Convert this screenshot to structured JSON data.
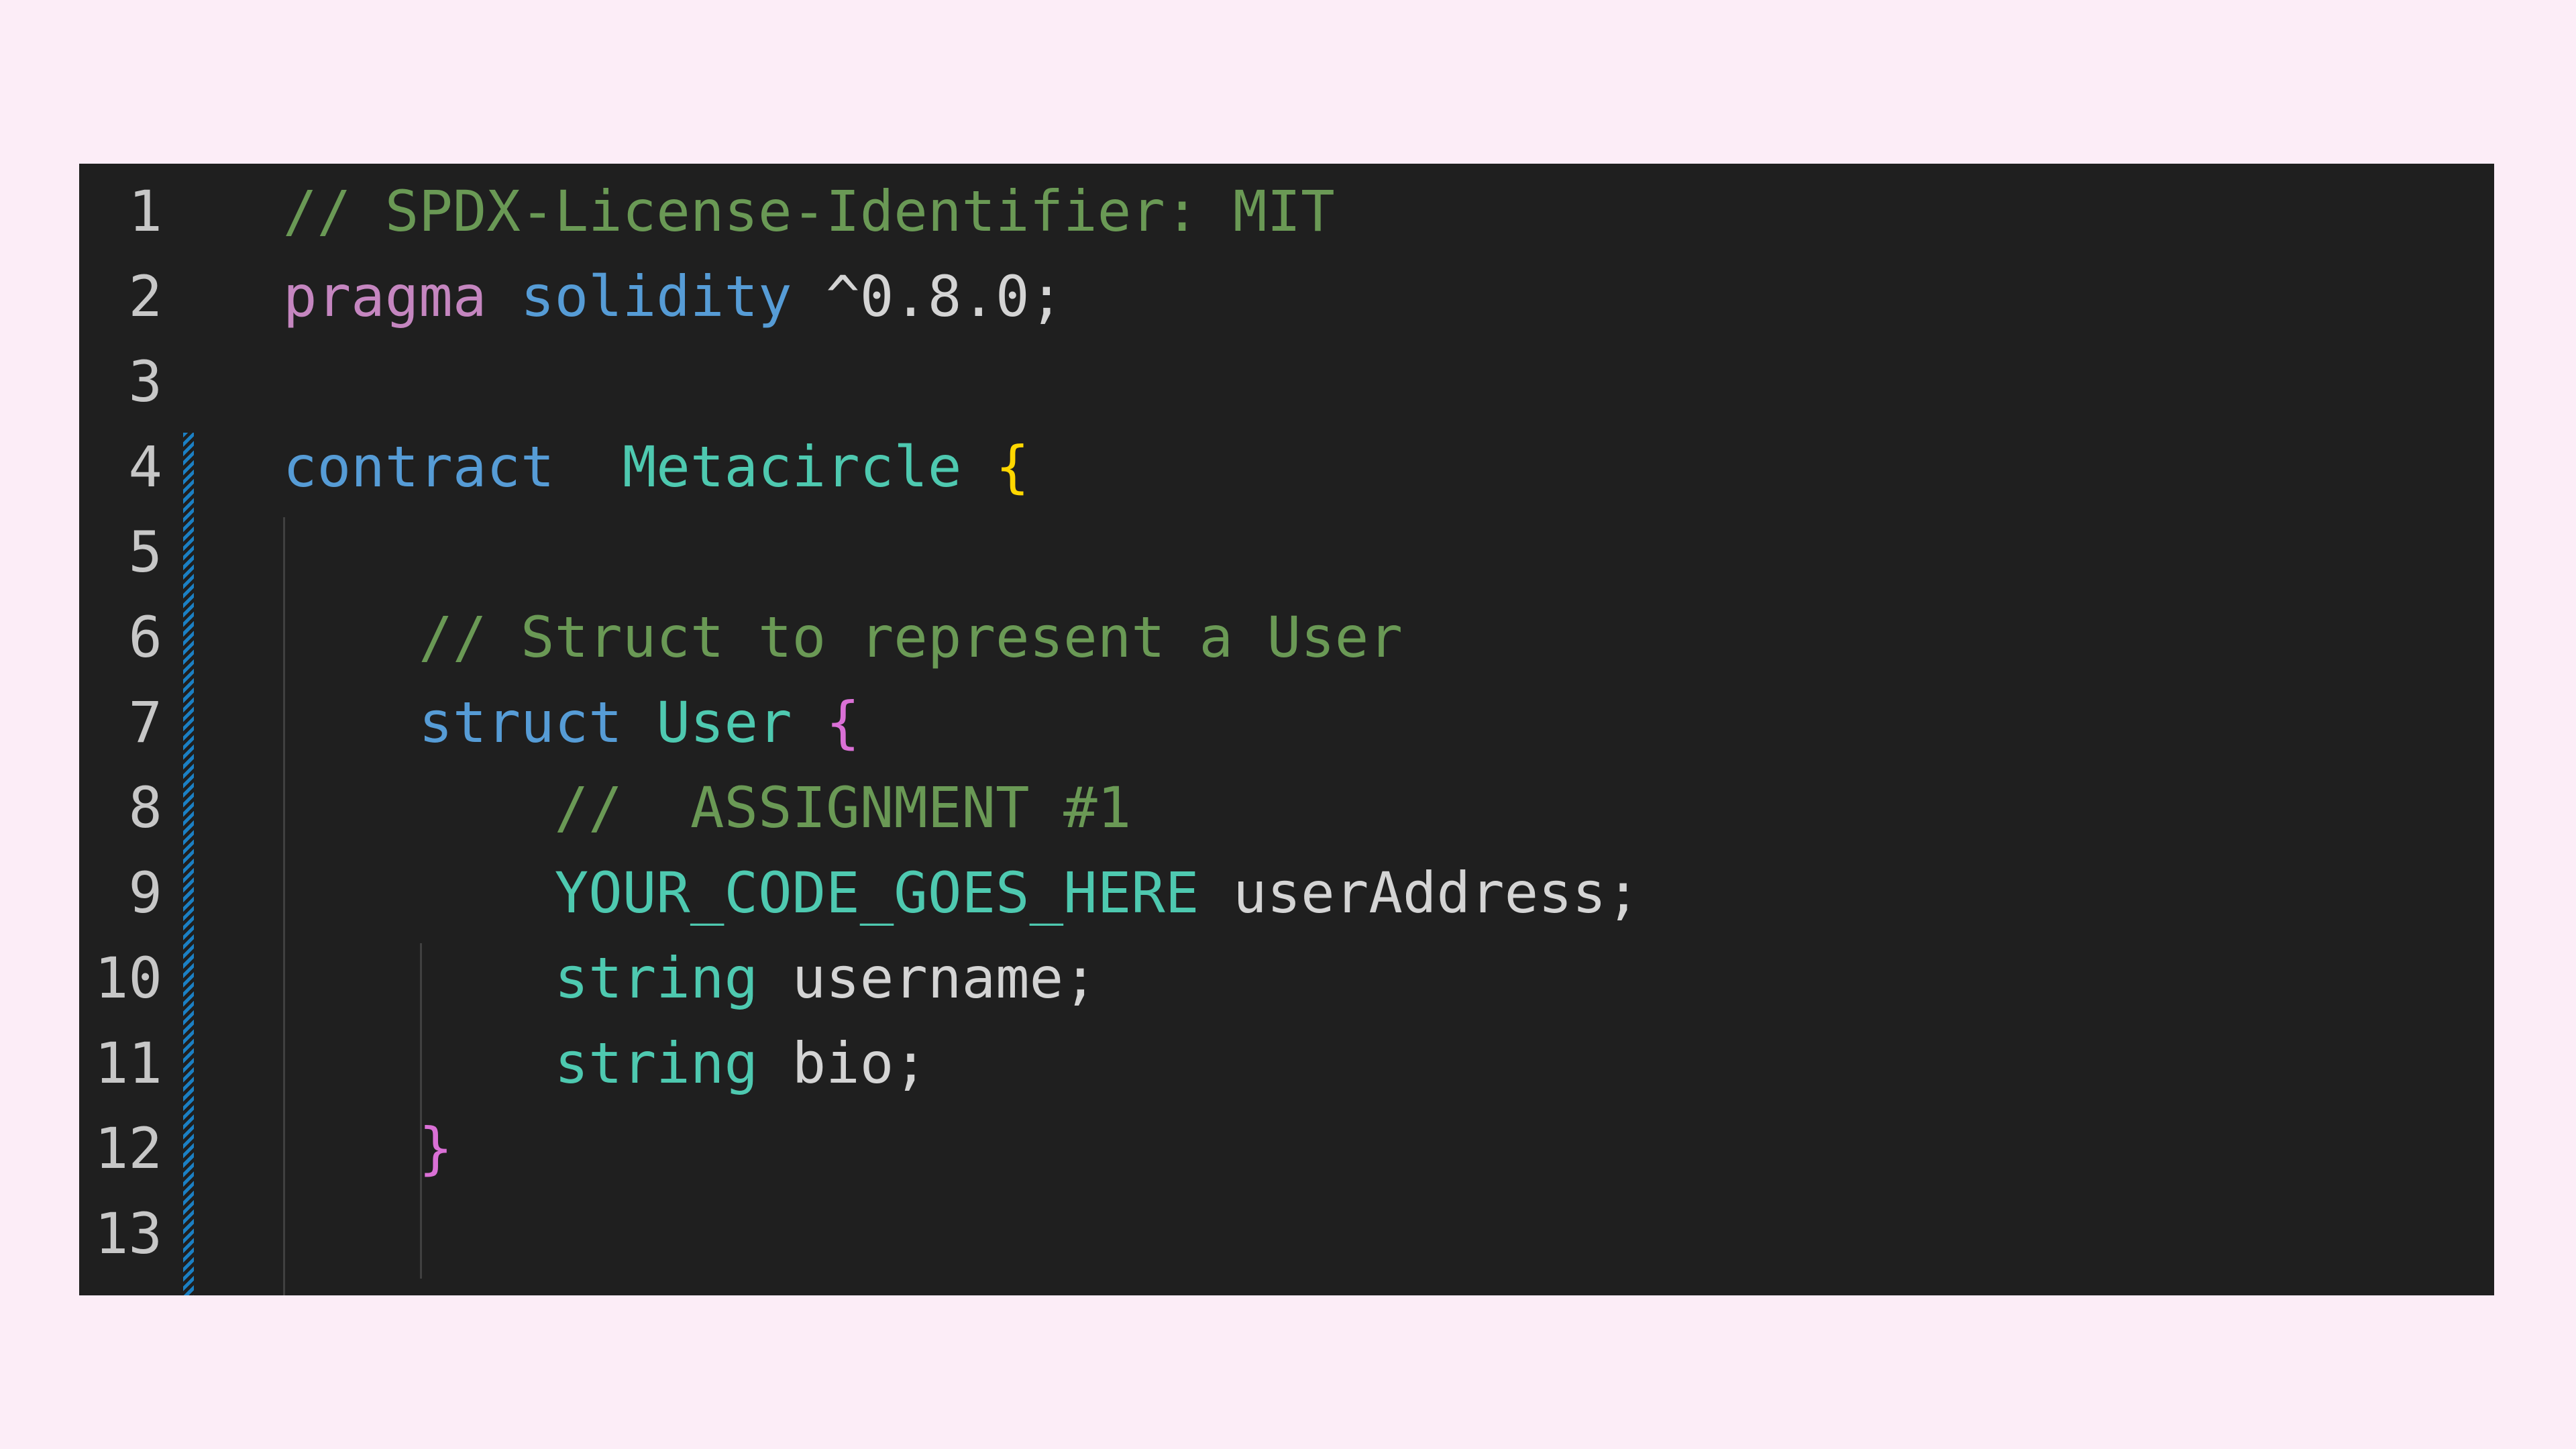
{
  "colors": {
    "page_background": "#fcedf7",
    "editor_background": "#1f1f1f",
    "line_number": "#c7c7c7",
    "comment": "#6a9955",
    "keyword_purple": "#c586c0",
    "keyword_blue": "#569cd6",
    "type_teal": "#4ec9b0",
    "plain": "#d4d4d4",
    "bracket_yellow": "#ffd700",
    "bracket_pink": "#da70d6",
    "modified_gutter": "#1b80c4",
    "indent_guide": "#404040"
  },
  "editor": {
    "lines": [
      {
        "number": "1",
        "tokens": [
          {
            "text": "// SPDX-License-Identifier: MIT",
            "kind": "comment"
          }
        ]
      },
      {
        "number": "2",
        "tokens": [
          {
            "text": "pragma",
            "kind": "keyword_purple"
          },
          {
            "text": " ",
            "kind": "plain"
          },
          {
            "text": "solidity",
            "kind": "keyword_blue"
          },
          {
            "text": " ^0.8.0;",
            "kind": "plain"
          }
        ]
      },
      {
        "number": "3",
        "tokens": []
      },
      {
        "number": "4",
        "tokens": [
          {
            "text": "contract",
            "kind": "keyword_blue"
          },
          {
            "text": "  ",
            "kind": "plain"
          },
          {
            "text": "Metacircle",
            "kind": "type_teal"
          },
          {
            "text": " ",
            "kind": "plain"
          },
          {
            "text": "{",
            "kind": "bracket_yellow"
          }
        ]
      },
      {
        "number": "5",
        "tokens": []
      },
      {
        "number": "6",
        "tokens": [
          {
            "text": "    // Struct to represent a User",
            "kind": "comment"
          }
        ]
      },
      {
        "number": "7",
        "tokens": [
          {
            "text": "    ",
            "kind": "plain"
          },
          {
            "text": "struct",
            "kind": "keyword_blue"
          },
          {
            "text": " ",
            "kind": "plain"
          },
          {
            "text": "User",
            "kind": "type_teal"
          },
          {
            "text": " ",
            "kind": "plain"
          },
          {
            "text": "{",
            "kind": "bracket_pink"
          }
        ]
      },
      {
        "number": "8",
        "tokens": [
          {
            "text": "        //  ASSIGNMENT #1",
            "kind": "comment"
          }
        ]
      },
      {
        "number": "9",
        "tokens": [
          {
            "text": "        ",
            "kind": "plain"
          },
          {
            "text": "YOUR_CODE_GOES_HERE",
            "kind": "type_teal"
          },
          {
            "text": " userAddress;",
            "kind": "plain"
          }
        ]
      },
      {
        "number": "10",
        "tokens": [
          {
            "text": "        ",
            "kind": "plain"
          },
          {
            "text": "string",
            "kind": "type_teal"
          },
          {
            "text": " username;",
            "kind": "plain"
          }
        ]
      },
      {
        "number": "11",
        "tokens": [
          {
            "text": "        ",
            "kind": "plain"
          },
          {
            "text": "string",
            "kind": "type_teal"
          },
          {
            "text": " bio;",
            "kind": "plain"
          }
        ]
      },
      {
        "number": "12",
        "tokens": [
          {
            "text": "    ",
            "kind": "plain"
          },
          {
            "text": "}",
            "kind": "bracket_pink"
          }
        ]
      },
      {
        "number": "13",
        "tokens": []
      }
    ]
  }
}
